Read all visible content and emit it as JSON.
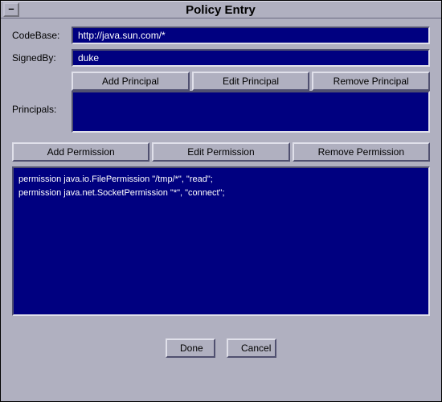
{
  "window": {
    "sys_glyph": "–",
    "title": "Policy Entry"
  },
  "labels": {
    "codebase": "CodeBase:",
    "signedby": "SignedBy:",
    "principals": "Principals:"
  },
  "fields": {
    "codebase": "http://java.sun.com/*",
    "signedby": "duke"
  },
  "buttons": {
    "add_principal": "Add Principal",
    "edit_principal": "Edit Principal",
    "remove_principal": "Remove Principal",
    "add_permission": "Add Permission",
    "edit_permission": "Edit Permission",
    "remove_permission": "Remove Permission",
    "done": "Done",
    "cancel": "Cancel"
  },
  "permissions": [
    "permission java.io.FilePermission \"/tmp/*\", \"read\";",
    "permission java.net.SocketPermission \"*\", \"connect\";"
  ],
  "colors": {
    "dialog_bg": "#b0b0c0",
    "field_bg": "#000080",
    "field_fg": "#ffffff"
  }
}
